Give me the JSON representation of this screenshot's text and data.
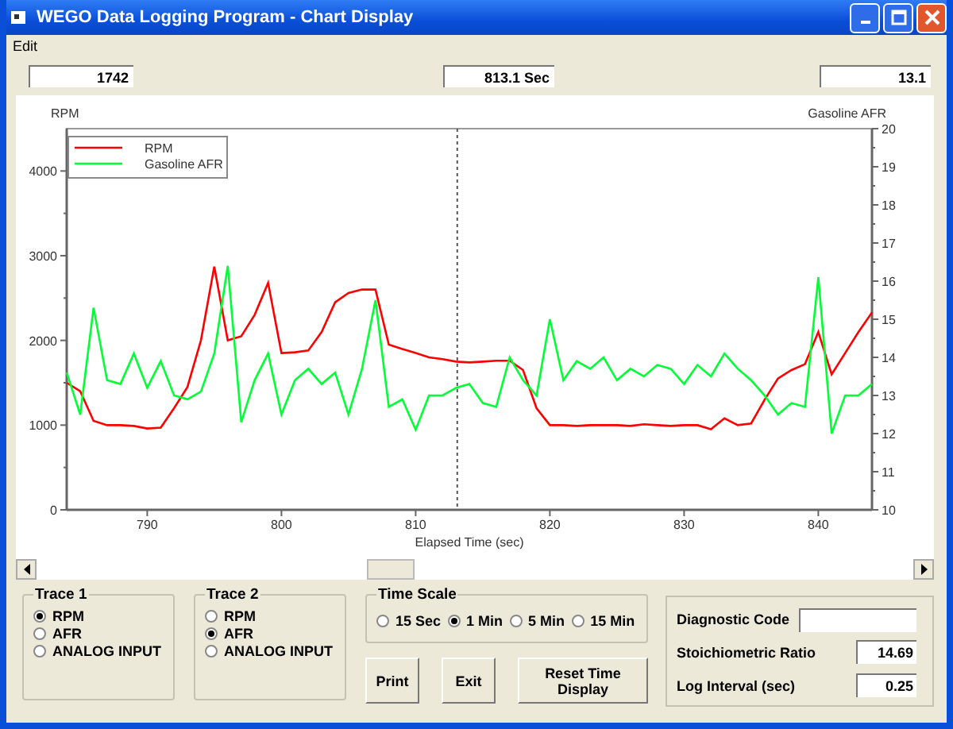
{
  "window": {
    "title": "WEGO Data Logging Program - Chart Display"
  },
  "menu": [
    "Edit"
  ],
  "readouts": [
    {
      "value": "1742"
    },
    {
      "value": "813.1 Sec"
    },
    {
      "value": "13.1"
    }
  ],
  "chart": {
    "chart_data": {
      "type": "line",
      "xlabel": "Elapsed Time (sec)",
      "ylabel": "RPM",
      "y2label": "Gasoline AFR",
      "xlim": [
        784,
        844
      ],
      "ylim": [
        0,
        4500
      ],
      "y2lim": [
        10,
        20
      ],
      "xticks": [
        790,
        800,
        810,
        820,
        830,
        840
      ],
      "yticks": [
        0,
        1000,
        2000,
        3000,
        4000
      ],
      "y2ticks": [
        10,
        11,
        12,
        13,
        14,
        15,
        16,
        17,
        18,
        19,
        20
      ],
      "ref_lines": [
        {
          "axis": "x",
          "value": 813.1
        }
      ],
      "legend": "upper left",
      "x": [
        784,
        785,
        786,
        787,
        788,
        789,
        790,
        791,
        792,
        793,
        794,
        795,
        796,
        797,
        798,
        799,
        800,
        801,
        802,
        803,
        804,
        805,
        806,
        807,
        808,
        809,
        810,
        811,
        812,
        813,
        814,
        815,
        816,
        817,
        818,
        819,
        820,
        821,
        822,
        823,
        824,
        825,
        826,
        827,
        828,
        829,
        830,
        831,
        832,
        833,
        834,
        835,
        836,
        837,
        838,
        839,
        840,
        841,
        842,
        843,
        844
      ],
      "series": [
        {
          "name": "RPM",
          "color": "#ff0000",
          "values": [
            1500,
            1400,
            1050,
            1000,
            1000,
            990,
            960,
            970,
            1200,
            1450,
            2000,
            2870,
            2000,
            2050,
            2300,
            2680,
            1850,
            1860,
            1880,
            2100,
            2450,
            2560,
            2600,
            2600,
            1950,
            1900,
            1850,
            1800,
            1780,
            1750,
            1740,
            1750,
            1760,
            1760,
            1650,
            1200,
            1000,
            1000,
            990,
            1000,
            1000,
            1000,
            990,
            1010,
            1000,
            990,
            1000,
            1000,
            950,
            1080,
            1000,
            1020,
            1300,
            1550,
            1650,
            1720,
            2100,
            1600,
            1850,
            2100,
            2330
          ]
        },
        {
          "name": "Gasoline AFR",
          "color": "#00ff33",
          "axis": "y2",
          "values": [
            13.6,
            12.5,
            15.3,
            13.4,
            13.3,
            14.1,
            13.2,
            13.9,
            13,
            12.9,
            13.1,
            14.1,
            16.4,
            12.3,
            13.4,
            14.1,
            12.5,
            13.4,
            13.7,
            13.3,
            13.6,
            12.5,
            13.7,
            15.5,
            12.7,
            12.9,
            12.1,
            13,
            13,
            13.2,
            13.3,
            12.8,
            12.7,
            14,
            13.4,
            13,
            15,
            13.4,
            13.9,
            13.7,
            14,
            13.4,
            13.7,
            13.5,
            13.8,
            13.7,
            13.3,
            13.8,
            13.5,
            14.1,
            13.7,
            13.4,
            13,
            12.5,
            12.8,
            12.7,
            16.1,
            12,
            13,
            13,
            13.3
          ]
        }
      ]
    }
  },
  "trace_groups": [
    {
      "title": "Trace 1",
      "options": [
        {
          "label": "RPM",
          "selected": true
        },
        {
          "label": "AFR",
          "selected": false
        },
        {
          "label": "ANALOG INPUT",
          "selected": false
        }
      ]
    },
    {
      "title": "Trace 2",
      "options": [
        {
          "label": "RPM",
          "selected": false
        },
        {
          "label": "AFR",
          "selected": true
        },
        {
          "label": "ANALOG INPUT",
          "selected": false
        }
      ]
    }
  ],
  "time_scale": {
    "title": "Time Scale",
    "options": [
      {
        "label": "15 Sec",
        "selected": false
      },
      {
        "label": "1 Min",
        "selected": true
      },
      {
        "label": "5 Min",
        "selected": false
      },
      {
        "label": "15 Min",
        "selected": false
      }
    ]
  },
  "buttons": [
    {
      "label": "Print",
      "kind": "small"
    },
    {
      "label": "Exit",
      "kind": "small"
    },
    {
      "label": "Reset Time Display",
      "kind": "wide"
    }
  ],
  "settings": [
    {
      "label": "Diagnostic Code",
      "kind": "wide"
    },
    {
      "label": "Stoichiometric Ratio",
      "value": "14.69",
      "kind": "narrow"
    },
    {
      "label": "Log Interval (sec)",
      "value": "0.25",
      "kind": "narrow"
    }
  ]
}
